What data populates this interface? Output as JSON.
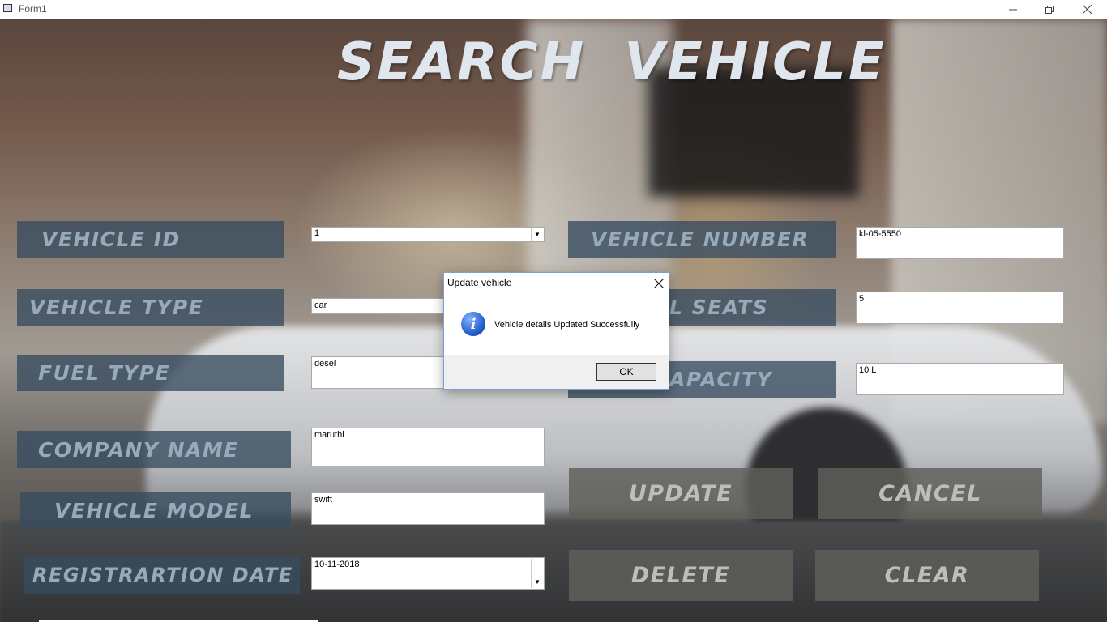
{
  "window": {
    "title": "Form1",
    "minimize_icon": "minimize-icon",
    "restore_icon": "restore-icon",
    "close_icon": "close-icon"
  },
  "heading": "SEARCH  VEHICLE",
  "labels": {
    "vehicle_id": "VEHICLE ID",
    "vehicle_type": "VEHICLE TYPE",
    "fuel_type": "FUEL TYPE",
    "company_name": "COMPANY NAME",
    "vehicle_model": "VEHICLE MODEL",
    "registration_date": "REGISTRARTION DATE",
    "vehicle_number": "VEHICLE NUMBER",
    "total_seats": "L SEATS",
    "capacity": "APACITY"
  },
  "fields": {
    "vehicle_id": "1",
    "vehicle_type": "car",
    "fuel_type": "desel",
    "company_name": "maruthi",
    "vehicle_model": "swift",
    "registration_date": "10-11-2018",
    "vehicle_number": "kl-05-5550",
    "total_seats": "5",
    "capacity": "10 L"
  },
  "buttons": {
    "update": "UPDATE",
    "cancel": "CANCEL",
    "delete": "DELETE",
    "clear": "CLEAR"
  },
  "dialog": {
    "title": "Update vehicle",
    "message": "Vehicle details Updated Successfully",
    "ok": "OK",
    "icon": "info-icon"
  }
}
